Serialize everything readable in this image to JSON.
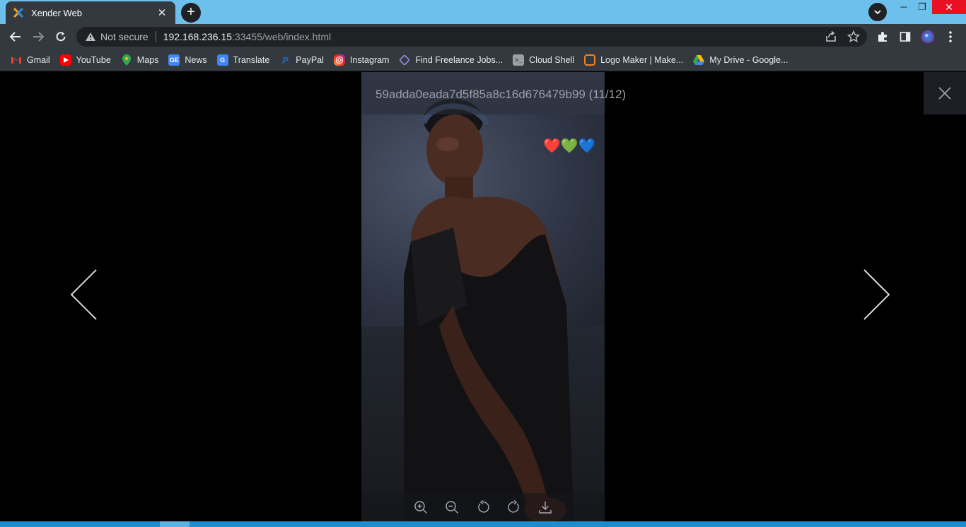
{
  "browser": {
    "tab": {
      "title": "Xender Web",
      "favicon": "xender-logo-icon"
    },
    "window_controls": [
      "minimize",
      "maximize",
      "close"
    ],
    "address_bar": {
      "security_label": "Not secure",
      "url_host": "192.168.236.15",
      "url_rest": ":33455/web/index.html"
    },
    "bookmarks": [
      {
        "label": "Gmail",
        "icon": "gmail-icon",
        "color": "#ea4335"
      },
      {
        "label": "YouTube",
        "icon": "youtube-icon",
        "color": "#ff0000"
      },
      {
        "label": "Maps",
        "icon": "maps-icon",
        "color": "#34a853"
      },
      {
        "label": "News",
        "icon": "news-icon",
        "color": "#4285f4"
      },
      {
        "label": "Translate",
        "icon": "translate-icon",
        "color": "#4285f4"
      },
      {
        "label": "PayPal",
        "icon": "paypal-icon",
        "color": "#003087"
      },
      {
        "label": "Instagram",
        "icon": "instagram-icon",
        "color": "#d6249f"
      },
      {
        "label": "Find Freelance Jobs...",
        "icon": "freelance-icon",
        "color": "#5b5ea6"
      },
      {
        "label": "Cloud Shell",
        "icon": "cloud-shell-icon",
        "color": "#9aa0a6"
      },
      {
        "label": "Logo Maker | Make...",
        "icon": "logo-maker-icon",
        "color": "#f4811f"
      },
      {
        "label": "My Drive - Google...",
        "icon": "drive-icon",
        "color": "#fbbc04"
      }
    ]
  },
  "viewer": {
    "title": "59adda0eada7d5f85a8c16d676479b99 (11/12)",
    "overlay_emoji": "❤️💚💙",
    "toolbar": [
      "zoom-in",
      "zoom-out",
      "rotate-left",
      "rotate-right",
      "download"
    ]
  },
  "colors": {
    "tab_strip": "#6ec0ec",
    "chrome_dark": "#33393f",
    "omnibox": "#202124",
    "close_red": "#e81123",
    "taskbar": "#1c8ed0"
  }
}
